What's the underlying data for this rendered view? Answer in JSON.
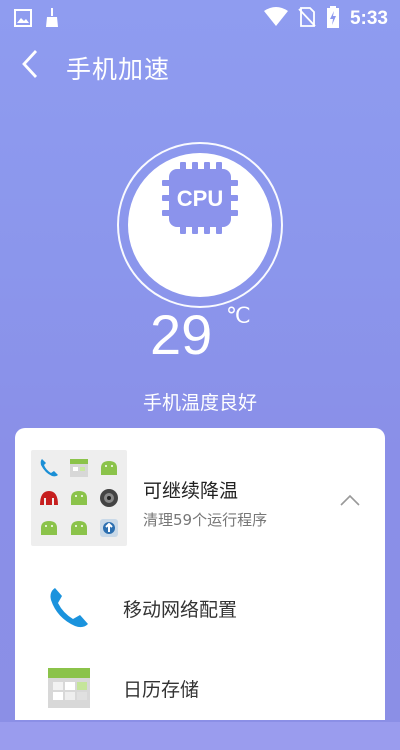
{
  "status_bar": {
    "time": "5:33",
    "icons": [
      "image-icon",
      "broom-icon",
      "wifi-icon",
      "no-sim-icon",
      "battery-charging-icon"
    ]
  },
  "header": {
    "title": "手机加速",
    "back_icon": "chevron-left-icon"
  },
  "cpu": {
    "chip_label": "CPU",
    "temperature": "29",
    "unit": "℃",
    "status": "手机温度良好"
  },
  "group": {
    "title": "可继续降温",
    "subtitle": "清理59个运行程序",
    "expanded": true
  },
  "items": [
    {
      "label": "移动网络配置",
      "icon": "phone-icon"
    },
    {
      "label": "日历存储",
      "icon": "calendar-icon"
    }
  ],
  "colors": {
    "accent": "#8b93ec",
    "card": "#ffffff",
    "chip": "#8b93ec"
  }
}
